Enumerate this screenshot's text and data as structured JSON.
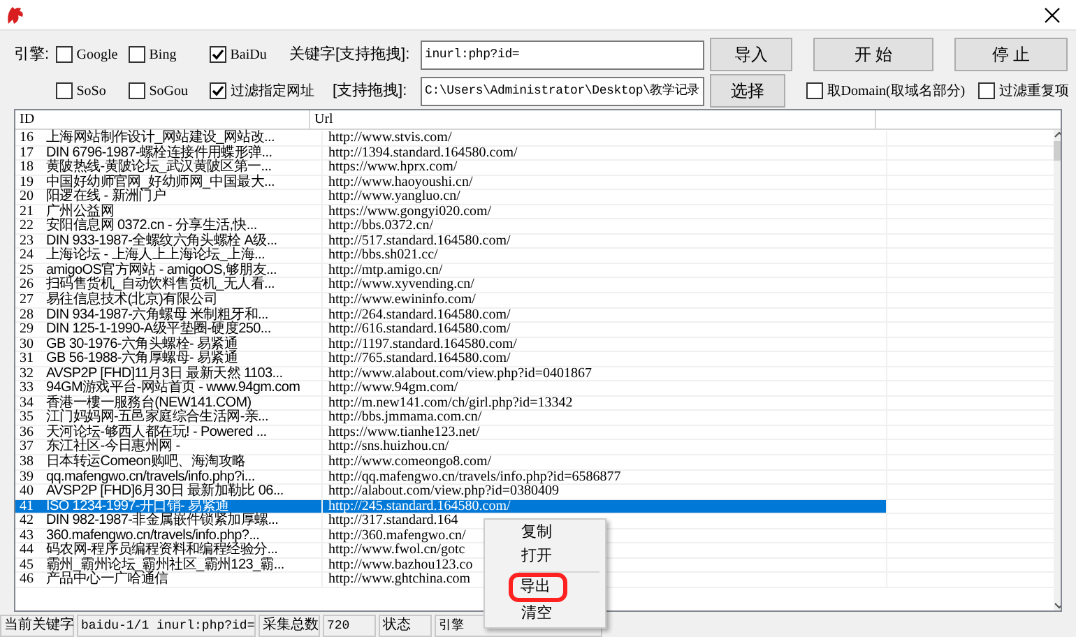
{
  "toolbar": {
    "rows": [
      [
        {
          "kind": "label",
          "text": "引擎:"
        },
        {
          "kind": "checkbox",
          "label": "Google",
          "checked": false
        },
        {
          "kind": "checkbox",
          "label": "Bing",
          "checked": false
        },
        {
          "kind": "checkbox",
          "label": "BaiDu",
          "checked": true
        },
        {
          "kind": "label",
          "text": "关键字[支持拖拽]:"
        },
        {
          "kind": "field",
          "value": "inurl:php?id="
        },
        {
          "kind": "button",
          "label": "导入"
        },
        {
          "kind": "button",
          "label": "开 始"
        },
        {
          "kind": "button",
          "label": "停 止"
        }
      ],
      [
        {
          "kind": "blank"
        },
        {
          "kind": "checkbox",
          "label": "SoSo",
          "checked": false
        },
        {
          "kind": "checkbox",
          "label": "SoGou",
          "checked": false
        },
        {
          "kind": "checkbox",
          "label": "过滤指定网址",
          "checked": true
        },
        {
          "kind": "label",
          "text": "[支持拖拽]:"
        },
        {
          "kind": "field",
          "value": "C:\\Users\\Administrator\\Desktop\\教学记录"
        },
        {
          "kind": "button",
          "label": "选择"
        },
        {
          "kind": "checkbox",
          "label": "取Domain(取域名部分)",
          "checked": false
        },
        {
          "kind": "checkbox",
          "label": "过滤重复项",
          "checked": false
        }
      ]
    ]
  },
  "table": {
    "columns": [
      "ID",
      "Url"
    ],
    "rows": [
      {
        "id": "16",
        "title": "上海网站制作设计_网站建设_网站改...",
        "url": "http://www.stvis.com/",
        "selected": false
      },
      {
        "id": "17",
        "title": "DIN 6796-1987-螺栓连接件用蝶形弹...",
        "url": "http://1394.standard.164580.com/",
        "selected": false
      },
      {
        "id": "18",
        "title": "黄陂热线-黄陂论坛_武汉黄陂区第一...",
        "url": "https://www.hprx.com/",
        "selected": false
      },
      {
        "id": "19",
        "title": "中国好幼师官网_好幼师网_中国最大...",
        "url": "http://www.haoyoushi.cn/",
        "selected": false
      },
      {
        "id": "20",
        "title": "阳逻在线 - 新洲门户",
        "url": "http://www.yangluo.cn/",
        "selected": false
      },
      {
        "id": "21",
        "title": "广州公益网",
        "url": "https://www.gongyi020.com/",
        "selected": false
      },
      {
        "id": "22",
        "title": "安阳信息网 0372.cn - 分享生活,快...",
        "url": "http://bbs.0372.cn/",
        "selected": false
      },
      {
        "id": "23",
        "title": "DIN 933-1987-全螺纹六角头螺栓 A级...",
        "url": "http://517.standard.164580.com/",
        "selected": false
      },
      {
        "id": "24",
        "title": "上海论坛 - 上海人上上海论坛_上海...",
        "url": "http://bbs.sh021.cc/",
        "selected": false
      },
      {
        "id": "25",
        "title": "amigoOS官方网站 - amigoOS,够朋友...",
        "url": "http://mtp.amigo.cn/",
        "selected": false
      },
      {
        "id": "26",
        "title": "扫码售货机_自动饮料售货机_无人看...",
        "url": "http://www.xyvending.cn/",
        "selected": false
      },
      {
        "id": "27",
        "title": "易往信息技术(北京)有限公司",
        "url": "http://www.ewininfo.com/",
        "selected": false
      },
      {
        "id": "28",
        "title": "DIN 934-1987-六角螺母 米制粗牙和...",
        "url": "http://264.standard.164580.com/",
        "selected": false
      },
      {
        "id": "29",
        "title": "DIN 125-1-1990-A级平垫圈-硬度250...",
        "url": "http://616.standard.164580.com/",
        "selected": false
      },
      {
        "id": "30",
        "title": "GB 30-1976-六角头螺栓- 易紧通",
        "url": "http://1197.standard.164580.com/",
        "selected": false
      },
      {
        "id": "31",
        "title": "GB 56-1988-六角厚螺母- 易紧通",
        "url": "http://765.standard.164580.com/",
        "selected": false
      },
      {
        "id": "32",
        "title": "AVSP2P [FHD]11月3日 最新天然 1103...",
        "url": "http://www.alabout.com/view.php?id=0401867",
        "selected": false
      },
      {
        "id": "33",
        "title": "94GM游戏平台-网站首页 - www.94gm.com",
        "url": "http://www.94gm.com/",
        "selected": false
      },
      {
        "id": "34",
        "title": "香港一樓一服務台(NEW141.COM)",
        "url": "http://m.new141.com/ch/girl.php?id=13342",
        "selected": false
      },
      {
        "id": "35",
        "title": "江门妈妈网-五邑家庭综合生活网-亲...",
        "url": "http://bbs.jmmama.com.cn/",
        "selected": false
      },
      {
        "id": "36",
        "title": "天河论坛-够西人都在玩! - Powered ...",
        "url": "https://www.tianhe123.net/",
        "selected": false
      },
      {
        "id": "37",
        "title": "东江社区-今日惠州网 -",
        "url": "http://sns.huizhou.cn/",
        "selected": false
      },
      {
        "id": "38",
        "title": "日本转运Comeon购吧、海淘攻略",
        "url": "http://www.comeongo8.com/",
        "selected": false
      },
      {
        "id": "39",
        "title": "qq.mafengwo.cn/travels/info.php?i...",
        "url": "http://qq.mafengwo.cn/travels/info.php?id=6586877",
        "selected": false
      },
      {
        "id": "40",
        "title": "AVSP2P [FHD]6月30日 最新加勒比 06...",
        "url": "http://alabout.com/view.php?id=0380409",
        "selected": false
      },
      {
        "id": "41",
        "title": "ISO 1234-1997-开口销- 易紧通",
        "url": "http://245.standard.164580.com/",
        "selected": true
      },
      {
        "id": "42",
        "title": "DIN 982-1987-非金属嵌件锁紧加厚螺...",
        "url": "http://317.standard.164",
        "selected": false
      },
      {
        "id": "43",
        "title": "360.mafengwo.cn/travels/info.php?...",
        "url": "http://360.mafengwo.cn/",
        "selected": false
      },
      {
        "id": "44",
        "title": "码农网-程序员编程资料和编程经验分...",
        "url": "http://www.fwol.cn/gotc",
        "selected": false
      },
      {
        "id": "45",
        "title": "霸州_霸州论坛_霸州社区_霸州123_霸...",
        "url": "http://www.bazhou123.co",
        "selected": false
      },
      {
        "id": "46",
        "title": "产品中心一广哈通信",
        "url": "http://www.ghtchina.com",
        "selected": false
      }
    ]
  },
  "status_bar": [
    {
      "kind": "label",
      "text": "当前关键字"
    },
    {
      "kind": "field",
      "text": "baidu-1/1 inurl:php?id="
    },
    {
      "kind": "label",
      "text": "采集总数"
    },
    {
      "kind": "field",
      "text": "720"
    },
    {
      "kind": "label",
      "text": "状态"
    },
    {
      "kind": "field",
      "text": "引擎"
    }
  ],
  "context_menu": [
    {
      "kind": "item",
      "label": "复制",
      "highlighted": false
    },
    {
      "kind": "item",
      "label": "打开",
      "highlighted": false
    },
    {
      "kind": "separator"
    },
    {
      "kind": "item",
      "label": "导出",
      "highlighted": true
    },
    {
      "kind": "item",
      "label": "清空",
      "highlighted": false
    }
  ]
}
